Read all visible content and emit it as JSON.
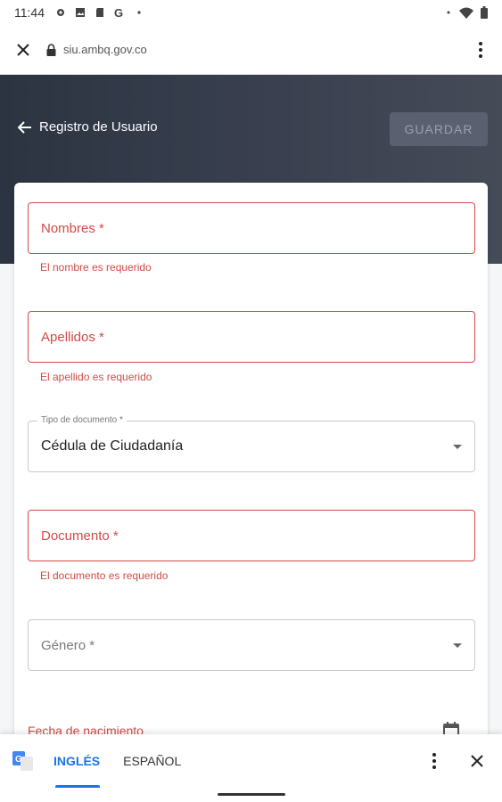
{
  "status_bar": {
    "time": "11:44",
    "icons": [
      "gear-icon",
      "image-icon",
      "sd-card-icon",
      "google-icon",
      "dot-icon",
      "wifi-icon",
      "battery-icon"
    ]
  },
  "browser": {
    "url": "siu.ambq.gov.co"
  },
  "header": {
    "back_label": "Registro de Usuario",
    "save_label": "GUARDAR"
  },
  "form": {
    "nombres": {
      "label": "Nombres *",
      "error": "El nombre es requerido"
    },
    "apellidos": {
      "label": "Apellidos *",
      "error": "El apellido es requerido"
    },
    "tipo_documento": {
      "label": "Tipo de documento *",
      "value": "Cédula de Ciudadanía"
    },
    "documento": {
      "label": "Documento *",
      "error": "El documento es requerido"
    },
    "genero": {
      "label": "Género *"
    },
    "fecha_nacimiento": {
      "label": "Fecha de nacimiento"
    }
  },
  "translate_bar": {
    "lang_active": "INGLÉS",
    "lang_other": "ESPAÑOL"
  },
  "colors": {
    "error": "#d24a47",
    "accent": "#1a73e8",
    "header": "#2c3442"
  }
}
